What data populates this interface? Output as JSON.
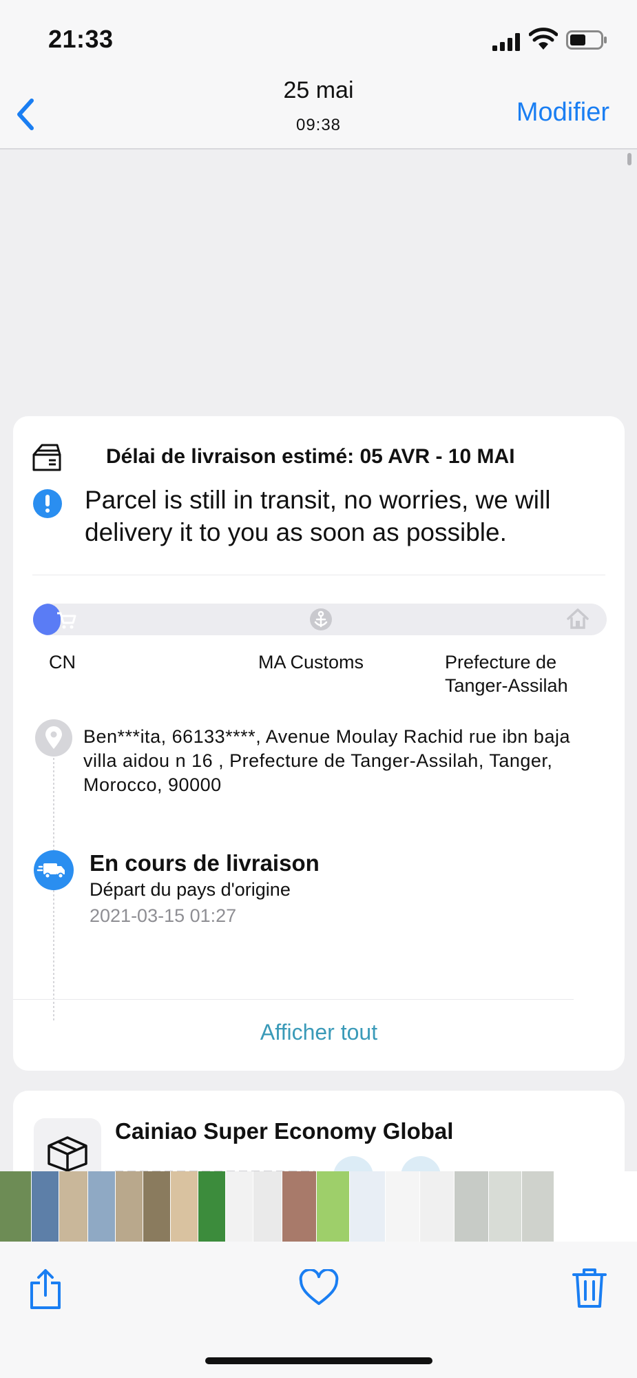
{
  "status_bar": {
    "time": "21:33"
  },
  "nav": {
    "date": "25 mai",
    "time": "09:38",
    "edit_label": "Modifier"
  },
  "tracking": {
    "delivery_estimate": "Délai de livraison estimé: 05 AVR - 10 MAI",
    "transit_message": "Parcel is still in transit, no worries, we will delivery it to you as soon as possible.",
    "progress_fraction": 0.04,
    "stages": [
      {
        "label": "CN",
        "icon": "cart-icon"
      },
      {
        "label": "MA Customs",
        "icon": "anchor-icon"
      },
      {
        "label": "Prefecture de Tanger-Assilah",
        "icon": "home-icon"
      }
    ],
    "address": "Ben***ita,  66133****,  Avenue Moulay Rachid rue ibn baja villa aidou n 16 ,  Prefecture de Tanger-Assilah,  Tanger,  Morocco,  90000",
    "latest_event": {
      "title": "En cours de livraison",
      "subtitle": "Départ du pays d'origine",
      "datetime": "2021-03-15 01:27"
    },
    "show_all_label": "Afficher tout"
  },
  "carrier": {
    "name": "Cainiao Super Economy Global"
  },
  "thumbnails": [
    {
      "color": "#6d8c55"
    },
    {
      "color": "#5d7fa8"
    },
    {
      "color": "#c9b79a"
    },
    {
      "color": "#8fa9c4"
    },
    {
      "color": "#b9a88c"
    },
    {
      "color": "#8a7b5e"
    },
    {
      "color": "#d9c2a0"
    },
    {
      "color": "#3c8c3c"
    },
    {
      "color": "#f2f2f2"
    },
    {
      "color": "#eaeaea"
    },
    {
      "color": "#a87a6a"
    },
    {
      "color": "#9ecf6a"
    },
    {
      "color": "#e8eef5"
    },
    {
      "color": "#f5f5f5"
    },
    {
      "color": "#f0f0f0"
    },
    {
      "color": "#c7cbc6"
    },
    {
      "color": "#d8dcd6"
    },
    {
      "color": "#cfd2cc"
    }
  ],
  "colors": {
    "accent": "#1a7ef2",
    "progress": "#5a7cf5",
    "link": "#3a9ab8"
  }
}
